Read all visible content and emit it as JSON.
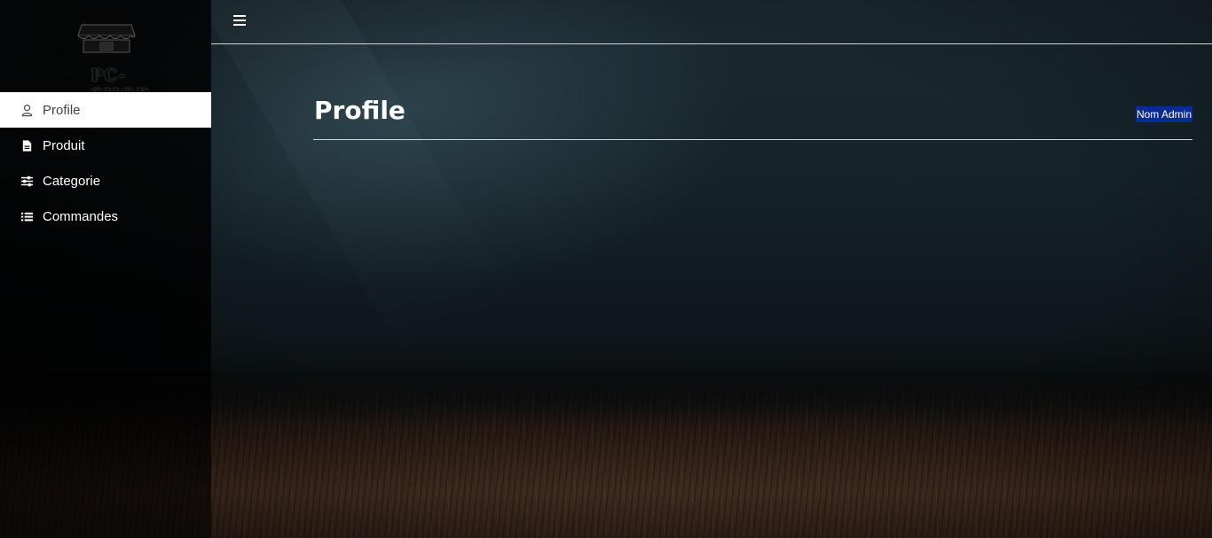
{
  "logo": {
    "text": "PC-SHOP",
    "icon": "shop-icon"
  },
  "topbar": {
    "menu_icon": "hamburger-icon"
  },
  "sidebar": {
    "items": [
      {
        "label": "Profile",
        "icon": "user-icon",
        "active": true
      },
      {
        "label": "Produit",
        "icon": "document-icon",
        "active": false
      },
      {
        "label": "Categorie",
        "icon": "sliders-icon",
        "active": false
      },
      {
        "label": "Commandes",
        "icon": "list-icon",
        "active": false
      }
    ]
  },
  "main": {
    "title": "Profile",
    "user_name": "Nom Admin"
  },
  "colors": {
    "active_bg": "#ffffff",
    "user_badge_bg": "#0a2a96"
  }
}
